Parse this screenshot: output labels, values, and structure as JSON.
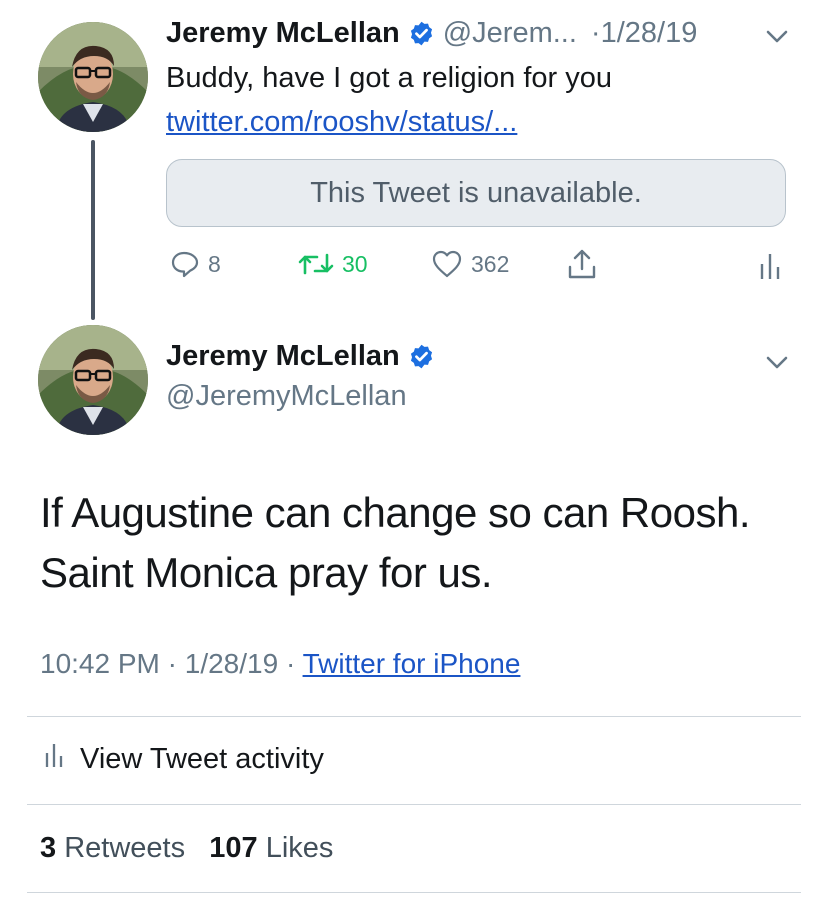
{
  "tweet_quoted": {
    "author_name": "Jeremy McLellan",
    "handle": "@Jerem...",
    "date": "·1/28/19",
    "text": "Buddy, have I got a religion for you",
    "link": "twitter.com/rooshv/status/...",
    "unavailable_text": "This Tweet is unavailable.",
    "replies": "8",
    "retweets": "30",
    "likes": "362"
  },
  "tweet_main": {
    "author_name": "Jeremy McLellan",
    "handle": "@JeremyMcLellan",
    "text_line1": "If Augustine can change so can Roosh.",
    "text_line2": "Saint Monica pray for us.",
    "time": "10:42 PM",
    "date": "1/28/19",
    "separator": "·",
    "source": "Twitter for iPhone",
    "activity_label": "View Tweet activity",
    "retweet_count": "3",
    "retweet_label": "Retweets",
    "like_count": "107",
    "like_label": "Likes"
  },
  "colors": {
    "verified": "#1d6fe0",
    "link": "#1b55c6",
    "retweet": "#17bf63",
    "muted": "#657786"
  },
  "icons": [
    "verified-badge-icon",
    "chevron-down-icon",
    "reply-icon",
    "retweet-icon",
    "like-icon",
    "share-icon",
    "analytics-icon"
  ]
}
